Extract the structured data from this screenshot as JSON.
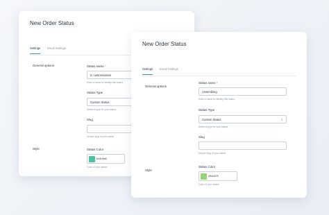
{
  "back_card": {
    "title": "New Order Status",
    "tabs": [
      {
        "label": "Settings",
        "active": true
      },
      {
        "label": "Email Settings",
        "active": false
      }
    ],
    "general_options_label": "General options",
    "status_name_label": "Status name",
    "status_name_required": "*",
    "status_name_value": "In customization",
    "status_name_hint": "Enter a name to identify this status",
    "status_type_label": "Status Type",
    "status_type_value": "Custom Status",
    "status_type_hint": "Select a type for your status",
    "slug_label": "Slug",
    "slug_value": "",
    "slug_hint": "Unique slug of your status",
    "style_label": "Style",
    "status_color_label": "Status Color",
    "status_color_hex": "#43c3a6",
    "status_color_swatch": "#4cc4a4",
    "status_color_hint": "Color of your status"
  },
  "front_card": {
    "title": "New Order Status",
    "tabs": [
      {
        "label": "Settings",
        "active": true
      },
      {
        "label": "Email Settings",
        "active": false
      }
    ],
    "general_options_label": "General options",
    "status_name_label": "Status name",
    "status_name_required": "*",
    "status_name_value": "Assembling",
    "status_name_hint": "Enter a name to identify this status",
    "status_type_label": "Status Type",
    "status_type_value": "Custom Status",
    "status_type_hint": "Select a type for your status",
    "slug_label": "Slug",
    "slug_value": "",
    "slug_hint": "Unique slug of your status",
    "style_label": "Style",
    "status_color_label": "Status Color",
    "status_color_hex": "#94d475",
    "status_color_swatch": "#94d475",
    "status_color_hint": "Color of your status"
  },
  "icons": {
    "select_caret": "chevron-updown-icon",
    "color_picker": "palette-icon"
  }
}
